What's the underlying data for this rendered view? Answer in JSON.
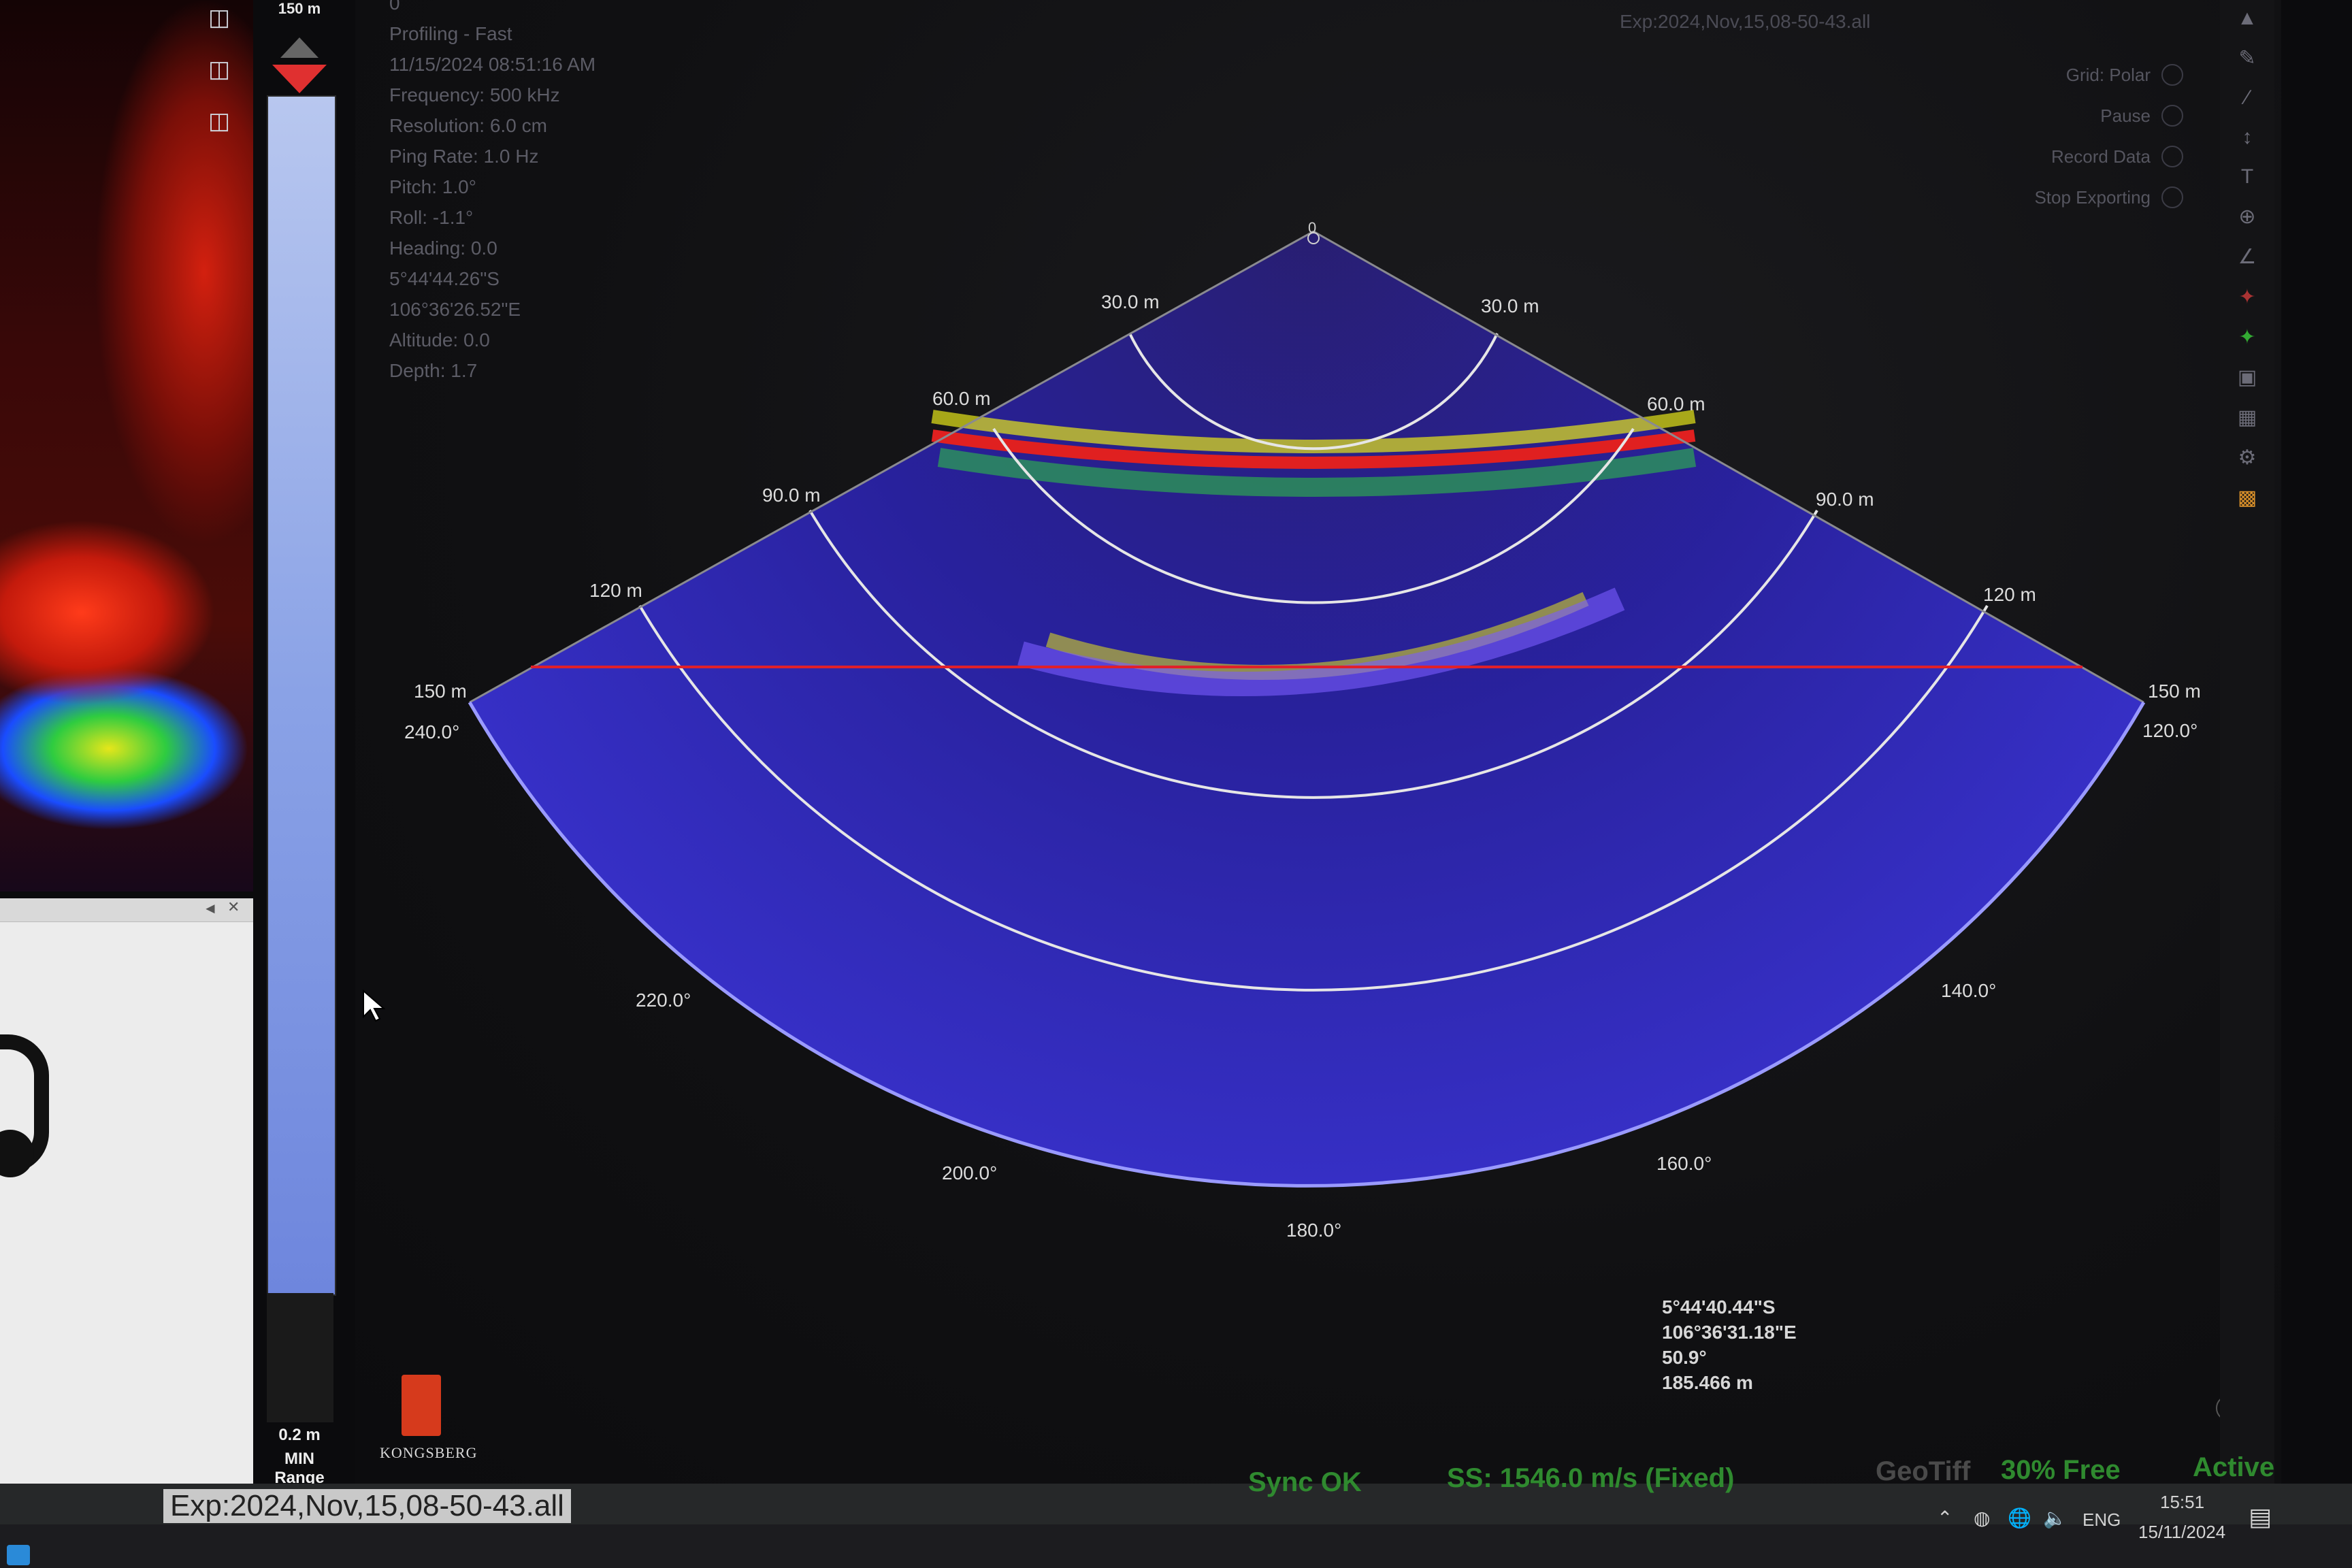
{
  "range_bar": {
    "top_value": "150 m",
    "min_value": "0.2 m",
    "min_label": "MIN Range"
  },
  "info": {
    "top_label": "0",
    "mode": "Profiling - Fast",
    "datetime": "11/15/2024 08:51:16 AM",
    "frequency": "Frequency: 500 kHz",
    "resolution": "Resolution: 6.0 cm",
    "ping_rate": "Ping Rate: 1.0 Hz",
    "pitch": "Pitch: 1.0°",
    "roll": "Roll: -1.1°",
    "heading": "Heading: 0.0",
    "lat": "5°44'44.26\"S",
    "lon": "106°36'26.52\"E",
    "altitude": "Altitude: 0.0",
    "depth": "Depth: 1.7"
  },
  "title": "Exp:2024,Nov,15,08-50-43.all",
  "controls": {
    "grid": "Grid: Polar",
    "pause": "Pause",
    "record": "Record Data",
    "stop_export": "Stop Exporting"
  },
  "sonar": {
    "apex_label": "0",
    "range_labels": [
      {
        "text": "30.0 m"
      },
      {
        "text": "30.0 m"
      },
      {
        "text": "60.0 m"
      },
      {
        "text": "60.0 m"
      },
      {
        "text": "90.0 m"
      },
      {
        "text": "90.0 m"
      },
      {
        "text": "120 m"
      },
      {
        "text": "120 m"
      },
      {
        "text": "150 m"
      },
      {
        "text": "150 m"
      }
    ],
    "angle_labels": [
      {
        "text": "240.0°"
      },
      {
        "text": "120.0°"
      },
      {
        "text": "220.0°"
      },
      {
        "text": "140.0°"
      },
      {
        "text": "200.0°"
      },
      {
        "text": "160.0°"
      },
      {
        "text": "180.0°"
      }
    ],
    "colors": {
      "low": "#3a2fd8",
      "mid": "#7a5cff",
      "high": "#e8e81a",
      "peak": "#e02020",
      "grid": "#e6e6e6",
      "cursor_line": "#e0202a"
    }
  },
  "brand": {
    "name": "KONGSBERG"
  },
  "cursor_info": {
    "lat": "5°44'40.44\"S",
    "lon": "106°36'31.18\"E",
    "angle": "50.9°",
    "range": "185.466 m"
  },
  "status": {
    "file": "Exp:2024,Nov,15,08-50-43.all",
    "sync": "Sync OK",
    "sound_speed": "SS: 1546.0 m/s (Fixed)",
    "geotiff": "GeoTiff",
    "disk": "30% Free",
    "state": "Active"
  },
  "taskbar": {
    "lang": "ENG",
    "time": "15:51",
    "date": "15/11/2024"
  }
}
